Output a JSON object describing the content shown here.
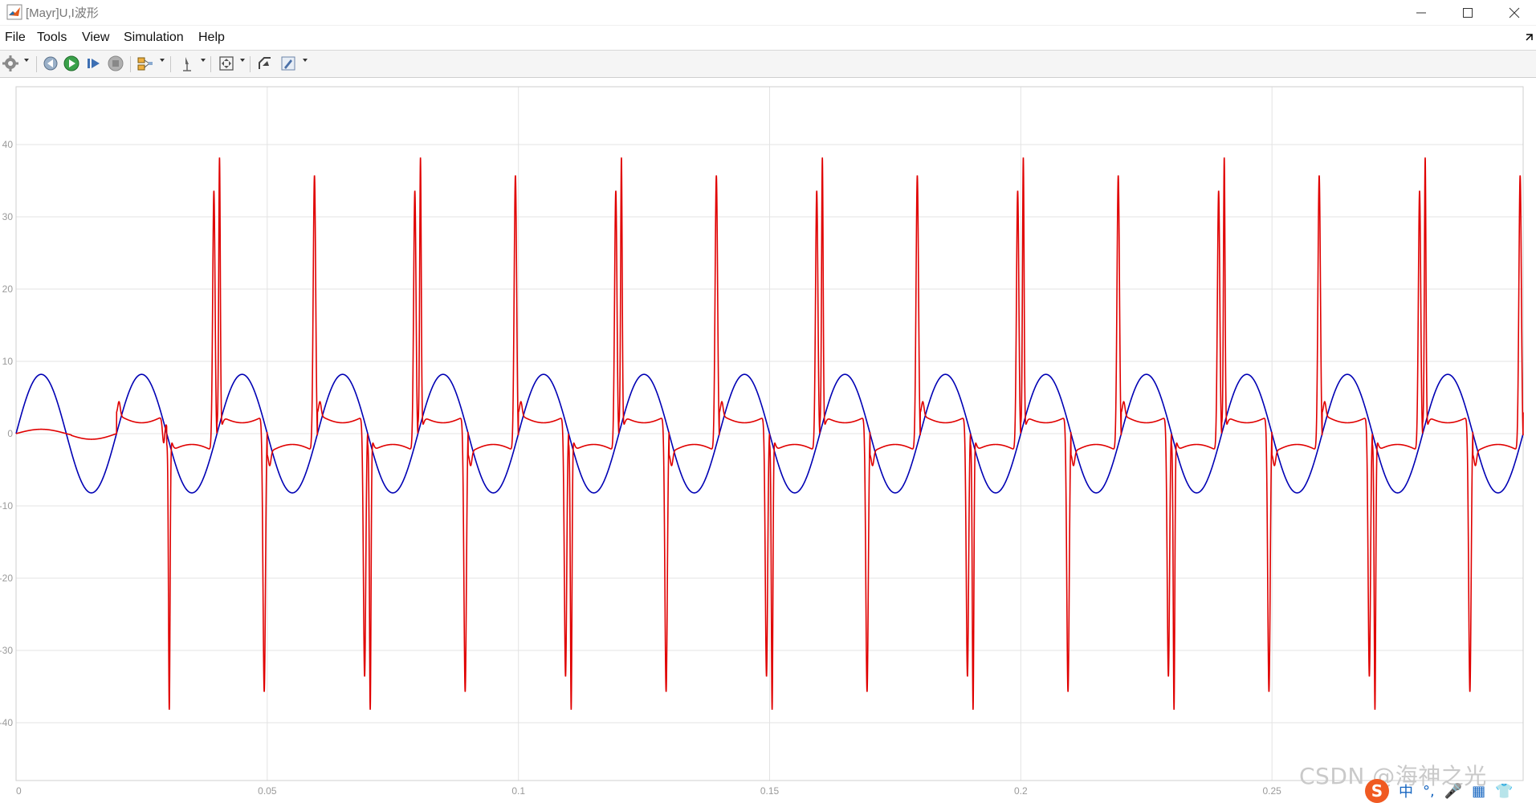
{
  "window": {
    "title": "[Mayr]U,I波形"
  },
  "menu": {
    "file": "File",
    "tools": "Tools",
    "view": "View",
    "simulation": "Simulation",
    "help": "Help"
  },
  "toolbar": {
    "icons": [
      "gear-icon",
      "step-back-icon",
      "run-icon",
      "step-forward-icon",
      "stop-icon",
      "highlight-icon",
      "cursor-icon",
      "zoom-fit-icon",
      "restore-icon",
      "style-icon"
    ]
  },
  "watermark": "CSDN @海神之光",
  "ime": {
    "logo": "S",
    "lang": "中",
    "punct": "°,"
  },
  "colors": {
    "voltage": "#e00000",
    "current": "#0000b4",
    "grid": "#e3e3e3",
    "tick": "#9a9a9a"
  },
  "chart_data": {
    "type": "line",
    "title": "",
    "xlabel": "",
    "ylabel": "",
    "xlim": [
      0,
      0.3
    ],
    "ylim": [
      -48,
      48
    ],
    "grid": true,
    "x_ticks": [
      "0",
      "0.05",
      "0.1",
      "0.15",
      "0.2",
      "0.25"
    ],
    "y_ticks": [
      "40",
      "30",
      "20",
      "10",
      "0",
      "-10",
      "-20",
      "-30",
      "-40"
    ],
    "series": [
      {
        "color": "#e00000",
        "period": 0.04,
        "spike_peak": 38.2,
        "spike_trough": -38.2,
        "plateau_level": 1.5,
        "first_positive_spike_x": 0.0405,
        "first_negative_spike_x": 0.0305
      },
      {
        "color": "#0000b4",
        "amplitude": 8.2,
        "period": 0.02,
        "first_peak_x": 0.005
      }
    ]
  }
}
